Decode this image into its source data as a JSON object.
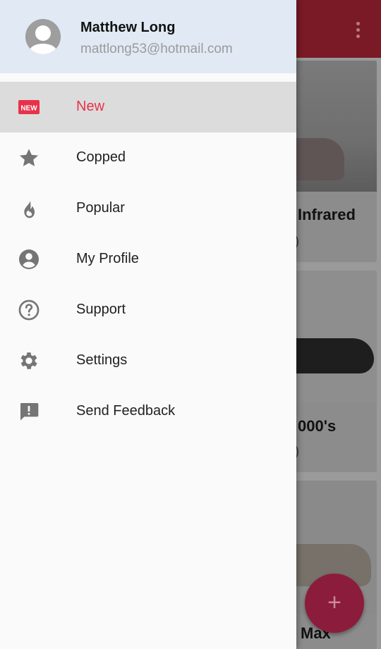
{
  "background": {
    "cards": [
      {
        "title": "Infrared",
        "price": ")"
      },
      {
        "title": "000's",
        "price": ")"
      },
      {
        "title": "Max"
      }
    ],
    "fab_label": "+"
  },
  "drawer": {
    "user": {
      "name": "Matthew Long",
      "email": "mattlong53@hotmail.com"
    },
    "items": [
      {
        "label": "New",
        "icon": "new-badge-icon",
        "active": true
      },
      {
        "label": "Copped",
        "icon": "star-icon"
      },
      {
        "label": "Popular",
        "icon": "flame-icon"
      },
      {
        "label": "My Profile",
        "icon": "account-circle-icon"
      },
      {
        "label": "Support",
        "icon": "help-circle-icon"
      },
      {
        "label": "Settings",
        "icon": "gear-icon"
      },
      {
        "label": "Send Feedback",
        "icon": "feedback-icon"
      }
    ],
    "new_badge_text": "NEW"
  },
  "colors": {
    "accent": "#e8324a",
    "header_bg": "#e1e9f4",
    "active_row_bg": "#dcdcdc",
    "icon_gray": "#757575"
  }
}
